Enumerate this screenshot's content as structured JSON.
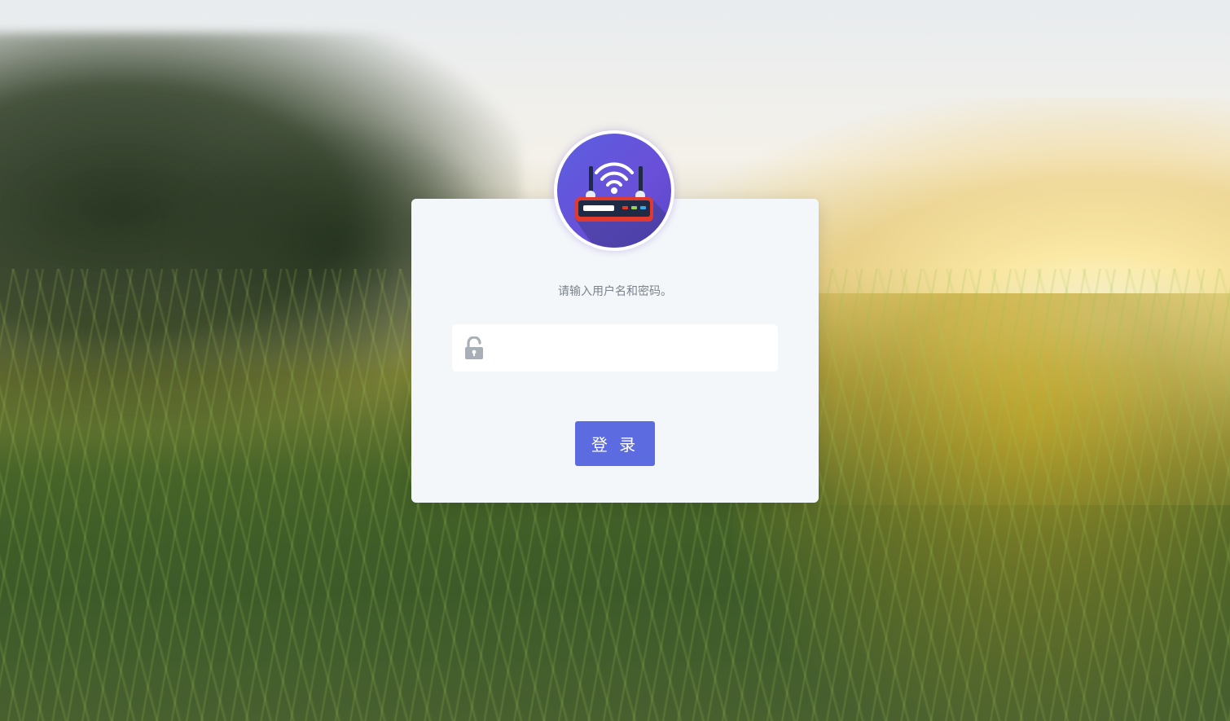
{
  "login": {
    "prompt": "请输入用户名和密码。",
    "password_placeholder": "",
    "password_value": "",
    "submit_label": "登 录"
  },
  "icons": {
    "logo": "wifi-router-icon",
    "field": "unlock-icon"
  },
  "colors": {
    "accent": "#5d6be0",
    "card": "#f4f7fa",
    "prompt_text": "#7a838c",
    "logo_bg": "#5b5fe0",
    "router_body": "#e03a2f"
  }
}
